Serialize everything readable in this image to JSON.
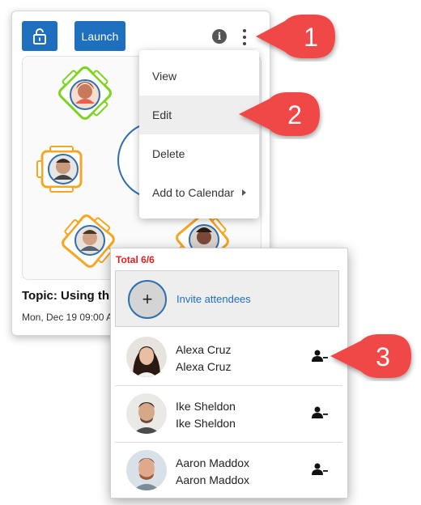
{
  "toolbar": {
    "lock_icon": "unlock-icon",
    "launch_label": "Launch",
    "info_icon_glyph": "i"
  },
  "room": {
    "topic": "Topic: Using th",
    "date": "Mon, Dec 19 09:00 A"
  },
  "menu": {
    "items": [
      {
        "label": "View"
      },
      {
        "label": "Edit",
        "highlighted": true
      },
      {
        "label": "Delete"
      },
      {
        "label": "Add to Calendar",
        "has_submenu": true
      }
    ]
  },
  "attendees": {
    "total": "Total 6/6",
    "invite_label": "Invite attendees",
    "invite_icon": "+",
    "list": [
      {
        "name": "Alexa Cruz",
        "subname": "Alexa Cruz"
      },
      {
        "name": "Ike Sheldon",
        "subname": "Ike Sheldon"
      },
      {
        "name": "Aaron Maddox",
        "subname": "Aaron Maddox"
      }
    ]
  },
  "callouts": [
    "1",
    "2",
    "3"
  ],
  "colors": {
    "primary": "#1f6fbf",
    "callout": "#f04747",
    "total": "#e02020",
    "chair_green": "#7ed321",
    "chair_orange": "#f5a623",
    "table_outline": "#2f6fb0"
  }
}
